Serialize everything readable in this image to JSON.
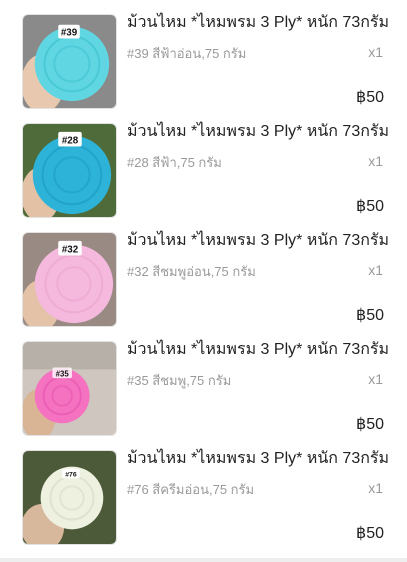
{
  "items": [
    {
      "title": "ม้วนไหม *ไหมพรม 3 Ply* หนัก 73กรัม",
      "variant": "#39 สีฟ้าอ่อน,75 กรัม",
      "qty": "x1",
      "price": "฿50",
      "tag": "#39",
      "color": "#5fd6e2",
      "color_dark": "#3bbfcd",
      "bg": "#8a8a8a",
      "hand": "#e8c9b0"
    },
    {
      "title": "ม้วนไหม *ไหมพรม 3 Ply* หนัก 73กรัม",
      "variant": "#28 สีฟ้า,75 กรัม",
      "qty": "x1",
      "price": "฿50",
      "tag": "#28",
      "color": "#2db3d8",
      "color_dark": "#1a98c0",
      "bg": "#4f6b3a",
      "hand": "#e2c1a5"
    },
    {
      "title": "ม้วนไหม *ไหมพรม 3 Ply* หนัก 73กรัม",
      "variant": "#32 สีชมพูอ่อน,75 กรัม",
      "qty": "x1",
      "price": "฿50",
      "tag": "#32",
      "color": "#f5b9de",
      "color_dark": "#e9a1cc",
      "bg": "#9a8a84",
      "hand": "#e3c2a8"
    },
    {
      "title": "ม้วนไหม *ไหมพรม 3 Ply* หนัก 73กรัม",
      "variant": "#35 สีชมพู,75 กรัม",
      "qty": "x1",
      "price": "฿50",
      "tag": "#35",
      "color": "#f472c0",
      "color_dark": "#e552ad",
      "bg": "#cfc6bf",
      "hand": "#d9b596"
    },
    {
      "title": "ม้วนไหม *ไหมพรม 3 Ply* หนัก 73กรัม",
      "variant": "#76 สีครีมอ่อน,75 กรัม",
      "qty": "x1",
      "price": "฿50",
      "tag": "#76",
      "color": "#eef0e0",
      "color_dark": "#d9dcc6",
      "bg": "#4c5a3a",
      "hand": "#d8b89c"
    }
  ]
}
